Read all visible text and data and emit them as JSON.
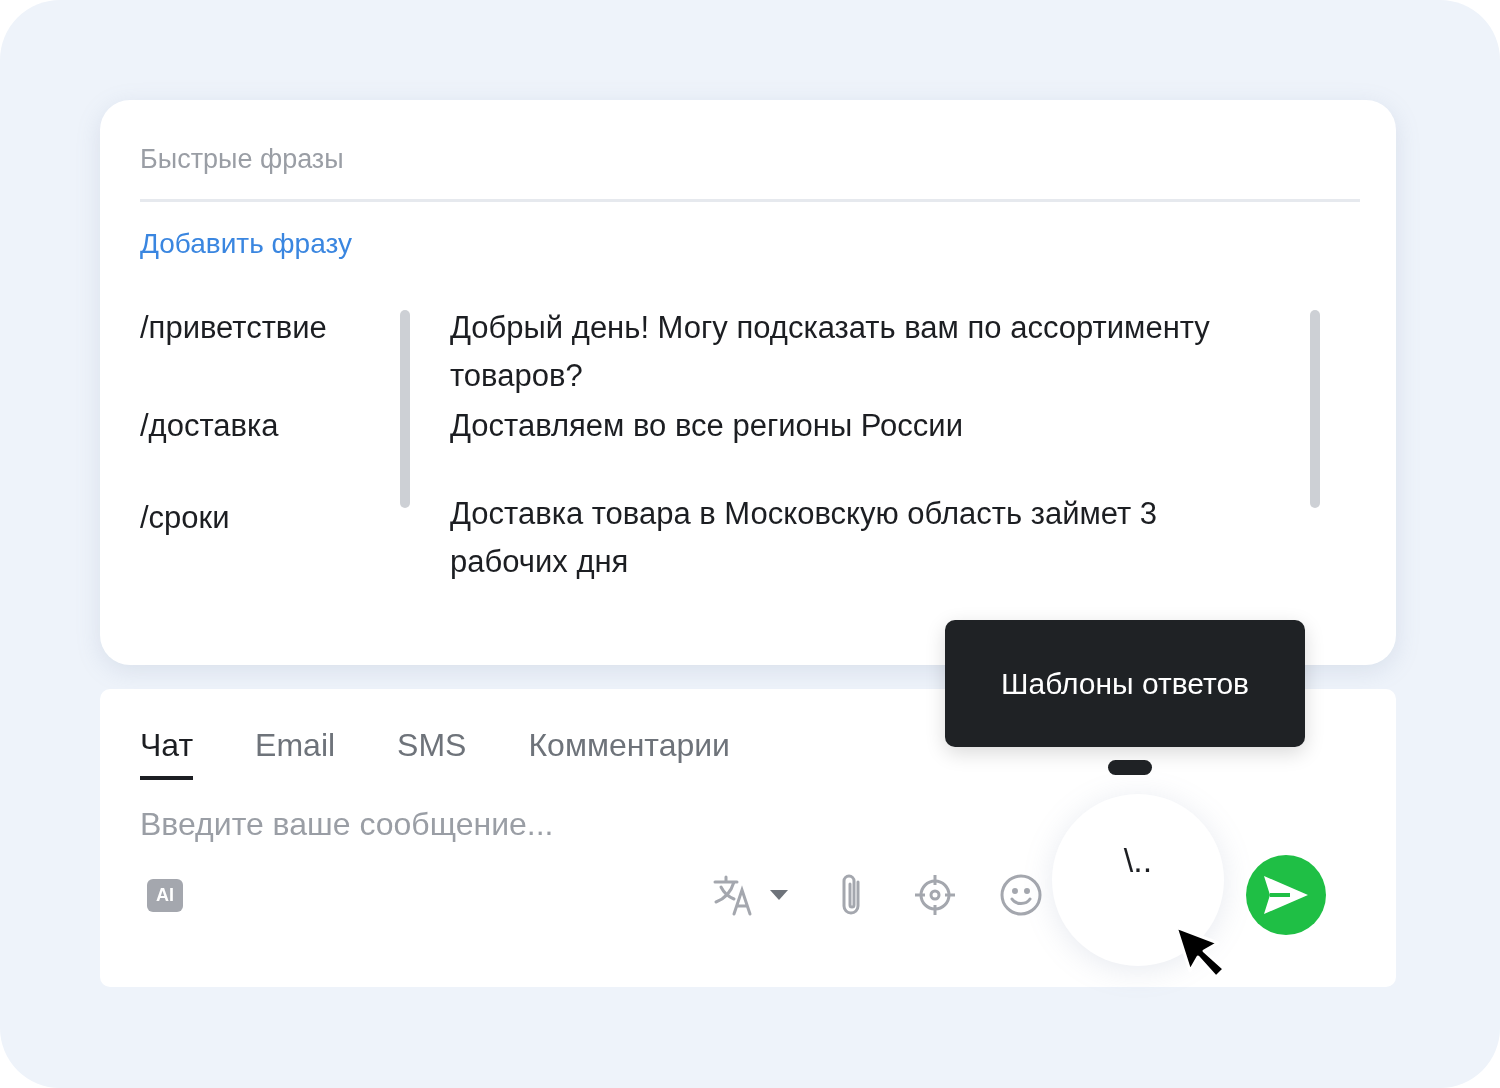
{
  "phrases_panel": {
    "search": {
      "placeholder": "Быстрые фразы"
    },
    "add_link": "Добавить фразу",
    "phrases": [
      {
        "command": "/приветствие",
        "text": "Добрый день! Могу подсказать вам по ассортименту товаров?"
      },
      {
        "command": "/доставка",
        "text": "Доставляем во все регионы России"
      },
      {
        "command": "/сроки",
        "text": "Доставка товара в Московскую область займет 3 рабочих дня"
      }
    ]
  },
  "composer": {
    "tabs": [
      {
        "label": "Чат",
        "selected": true
      },
      {
        "label": "Email",
        "selected": false
      },
      {
        "label": "SMS",
        "selected": false
      },
      {
        "label": "Комментарии",
        "selected": false
      }
    ],
    "message": {
      "placeholder": "Введите ваше сообщение..."
    },
    "ai_badge": "AI",
    "templates_button": "\\..",
    "tooltip": "Шаблоны ответов"
  }
}
